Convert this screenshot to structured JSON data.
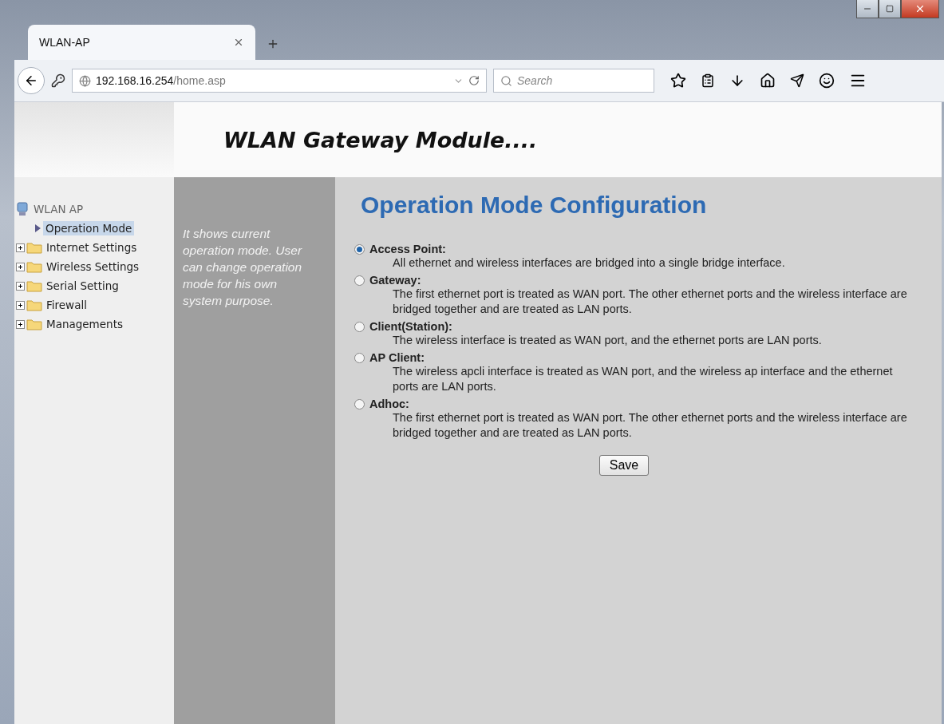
{
  "browser": {
    "tab": {
      "title": "WLAN-AP",
      "selected": true
    },
    "url": {
      "host": "192.168.16.254",
      "path": "/home.asp"
    },
    "search": {
      "placeholder": "Search"
    }
  },
  "banner": {
    "title": "WLAN Gateway Module...."
  },
  "tree": {
    "root": "WLAN AP",
    "items": [
      {
        "label": "Operation Mode",
        "kind": "page",
        "selected": true
      },
      {
        "label": "Internet Settings",
        "kind": "folder",
        "selected": false,
        "expanded": false
      },
      {
        "label": "Wireless Settings",
        "kind": "folder",
        "selected": false,
        "expanded": false
      },
      {
        "label": "Serial Setting",
        "kind": "folder",
        "selected": false,
        "expanded": false
      },
      {
        "label": "Firewall",
        "kind": "folder",
        "selected": false,
        "expanded": false
      },
      {
        "label": "Managements",
        "kind": "folder",
        "selected": false,
        "expanded": false
      }
    ]
  },
  "help": "It shows current operation mode. User can change operation mode for his own system purpose.",
  "main": {
    "title": "Operation Mode Configuration",
    "modes": [
      {
        "label": "Access Point:",
        "description": "All ethernet and wireless interfaces are bridged into a single bridge interface.",
        "selected": true
      },
      {
        "label": "Gateway:",
        "description": "The first ethernet port is treated as WAN port. The other ethernet ports and the wireless interface are bridged together and are treated as LAN ports.",
        "selected": false
      },
      {
        "label": "Client(Station):",
        "description": "The wireless interface is treated as WAN port, and the ethernet ports are LAN ports.",
        "selected": false
      },
      {
        "label": "AP Client:",
        "description": "The wireless apcli interface is treated as WAN port, and the wireless ap interface and the ethernet ports are LAN ports.",
        "selected": false
      },
      {
        "label": "Adhoc:",
        "description": "The first ethernet port is treated as WAN port. The other ethernet ports and the wireless interface are bridged together and are treated as LAN ports.",
        "selected": false
      }
    ],
    "button": "Save"
  }
}
